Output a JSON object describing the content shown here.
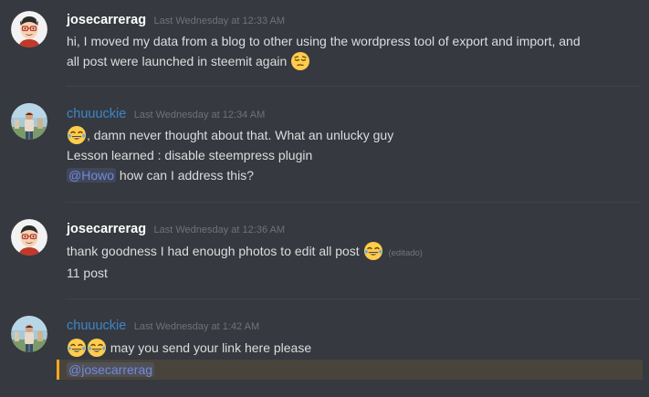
{
  "messages": [
    {
      "username": "josecarrerag",
      "timestamp": "Last Wednesday at 12:33 AM",
      "lines": [
        "hi, I moved my data from a blog to other using the wordpress tool of export and import, and",
        "all post were launched in steemit again"
      ],
      "emoji": "pensive-face"
    },
    {
      "username": "chuuuckie",
      "timestamp": "Last Wednesday at 12:34 AM",
      "lines": [
        ", damn never thought about that. What an unlucky guy",
        "Lesson learned : disable steempress plugin",
        "how can I address this?"
      ],
      "mention": "@Howo",
      "emoji": "tears-of-joy-face"
    },
    {
      "username": "josecarrerag",
      "timestamp": "Last Wednesday at 12:36 AM",
      "lines": [
        "thank goodness I had enough photos to edit all post",
        "11 post"
      ],
      "edited_label": "(editado)",
      "emoji": "tears-of-joy-face"
    },
    {
      "username": "chuuuckie",
      "timestamp": "Last Wednesday at 1:42 AM",
      "lines": [
        "may you send your link here please"
      ],
      "mention": "@josecarrerag",
      "emoji": "tears-of-joy-face"
    }
  ],
  "colors": {
    "background": "#36393f",
    "username_white": "#ffffff",
    "username_blue": "#3d86c8",
    "timestamp": "#6f7278",
    "text": "#dcddde",
    "mention": "#7289da",
    "highlight_border": "#faa61a"
  }
}
